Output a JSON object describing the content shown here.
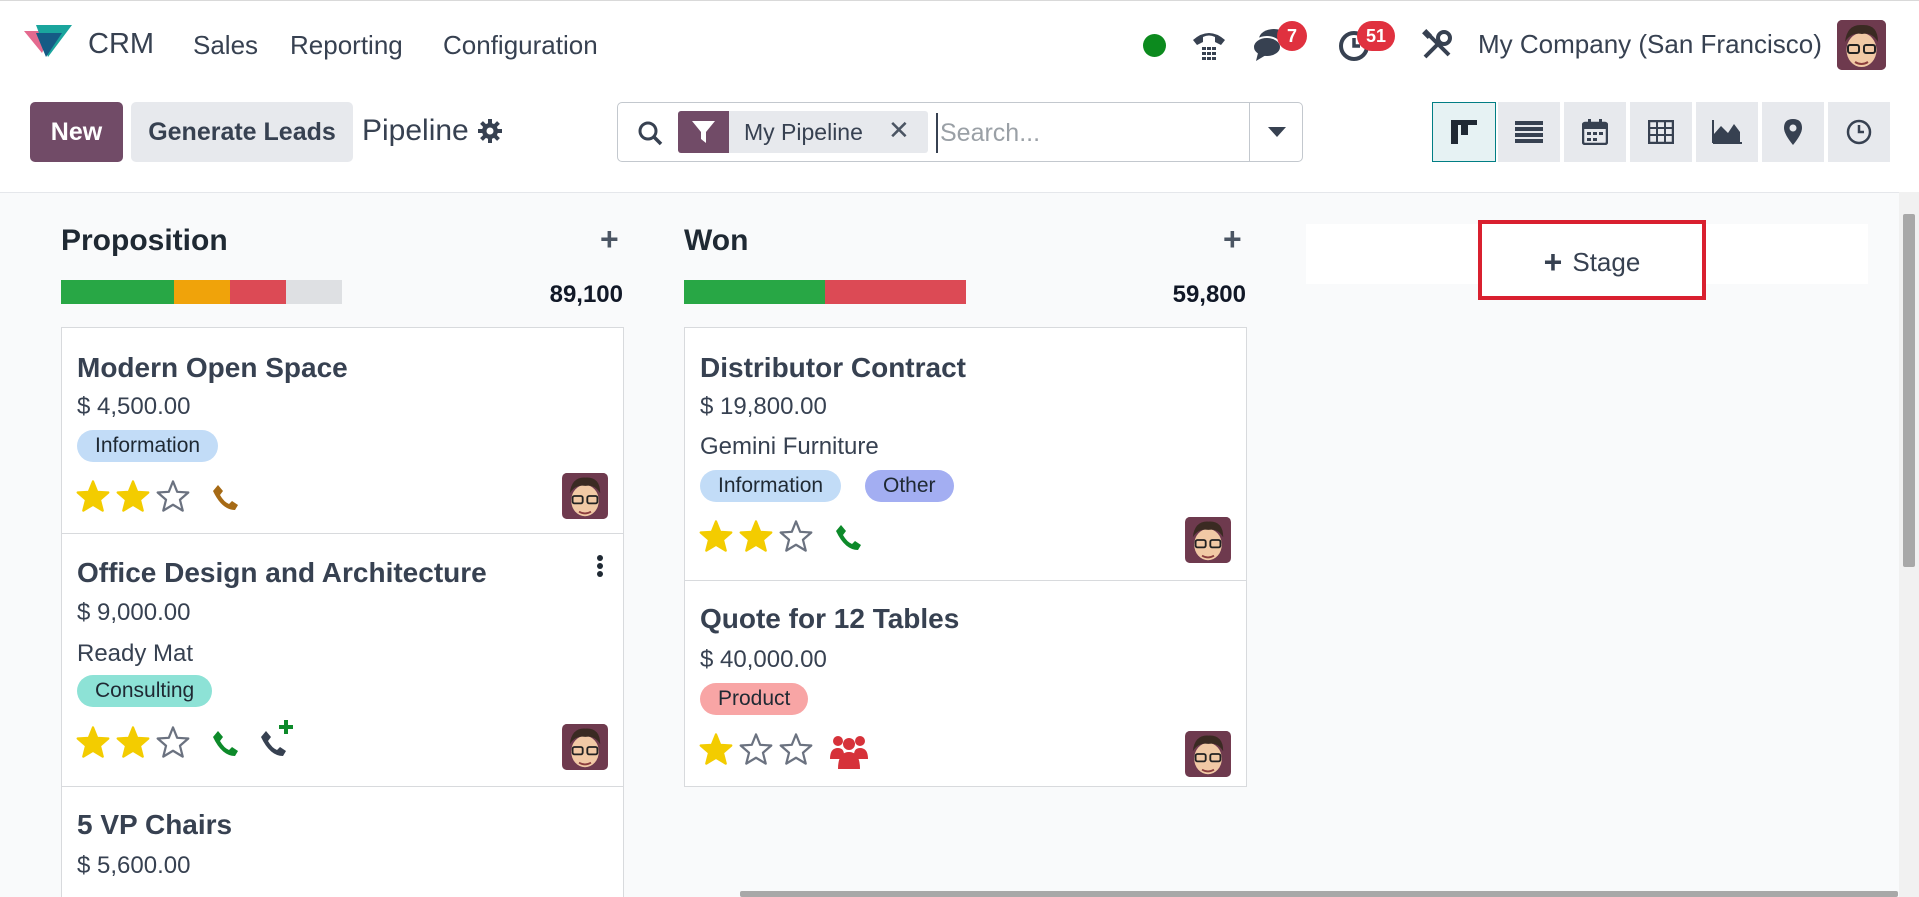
{
  "navbar": {
    "app_name": "CRM",
    "menu": [
      "Sales",
      "Reporting",
      "Configuration"
    ],
    "messages_badge": "7",
    "activities_badge": "51",
    "company": "My Company (San Francisco)"
  },
  "control_panel": {
    "new_label": "New",
    "generate_label": "Generate Leads",
    "breadcrumb": "Pipeline",
    "facet_label": "My Pipeline",
    "search_placeholder": "Search..."
  },
  "views": [
    "kanban",
    "list",
    "calendar",
    "pivot",
    "graph",
    "map",
    "activity"
  ],
  "columns": [
    {
      "title": "Proposition",
      "total": "89,100",
      "progress": [
        {
          "fraction": 0.2,
          "color": "#28a745"
        },
        {
          "fraction": 0.1,
          "color": "#f0a30a"
        },
        {
          "fraction": 0.1,
          "color": "#dc4a55"
        },
        {
          "fraction": 0.1,
          "color": "#dee0e3"
        }
      ],
      "cards": [
        {
          "title": "Modern Open Space",
          "amount": "$ 4,500.00",
          "tags": [
            {
              "label": "Information",
              "color": "#c2dcf7"
            }
          ],
          "stars": 2
        },
        {
          "title": "Office Design and Architecture",
          "amount": "$ 9,000.00",
          "partner": "Ready Mat",
          "tags": [
            {
              "label": "Consulting",
              "color": "#8de2d6"
            }
          ],
          "stars": 2
        },
        {
          "title": "5 VP Chairs",
          "amount": "$ 5,600.00"
        }
      ]
    },
    {
      "title": "Won",
      "total": "59,800",
      "progress": [
        {
          "fraction": 0.25,
          "color": "#28a745"
        },
        {
          "fraction": 0.25,
          "color": "#dc4a55"
        }
      ],
      "cards": [
        {
          "title": "Distributor Contract",
          "amount": "$ 19,800.00",
          "partner": "Gemini Furniture",
          "tags": [
            {
              "label": "Information",
              "color": "#c2dcf7"
            },
            {
              "label": "Other",
              "color": "#a3aef2"
            }
          ],
          "stars": 2
        },
        {
          "title": "Quote for 12 Tables",
          "amount": "$ 40,000.00",
          "tags": [
            {
              "label": "Product",
              "color": "#f8a5a5"
            }
          ],
          "stars": 1
        }
      ]
    }
  ],
  "stage_button_label": "Stage"
}
